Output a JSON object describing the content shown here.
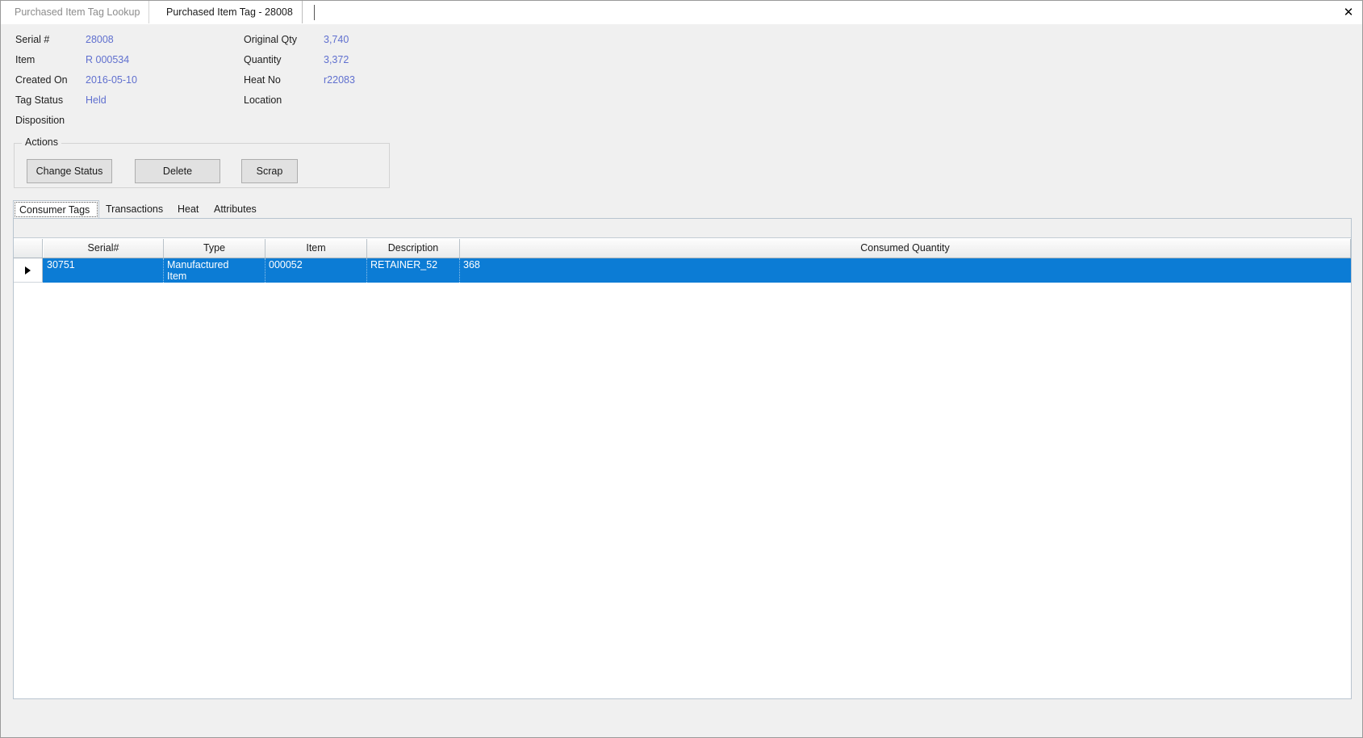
{
  "window": {
    "close_label": "✕"
  },
  "doc_tabs": [
    {
      "label": "Purchased Item Tag Lookup",
      "active": false
    },
    {
      "label": "Purchased Item Tag - 28008",
      "active": true
    }
  ],
  "details": {
    "left_column": [
      {
        "label": "Serial #",
        "value": "28008"
      },
      {
        "label": "Item",
        "value": "R 000534"
      },
      {
        "label": "Created On",
        "value": "2016-05-10"
      },
      {
        "label": "Tag Status",
        "value": "Held"
      },
      {
        "label": "Disposition",
        "value": ""
      }
    ],
    "right_column": [
      {
        "label": "Original Qty",
        "value": "3,740"
      },
      {
        "label": "Quantity",
        "value": "3,372"
      },
      {
        "label": "Heat No",
        "value": "r22083"
      },
      {
        "label": "Location",
        "value": ""
      }
    ]
  },
  "actions": {
    "legend": "Actions",
    "buttons": [
      {
        "label": "Change Status"
      },
      {
        "label": "Delete"
      },
      {
        "label": "Scrap"
      }
    ]
  },
  "inner_tabs": [
    {
      "label": "Consumer Tags",
      "selected": true
    },
    {
      "label": "Transactions",
      "selected": false
    },
    {
      "label": "Heat",
      "selected": false
    },
    {
      "label": "Attributes",
      "selected": false
    }
  ],
  "grid": {
    "columns": [
      "Serial#",
      "Type",
      "Item",
      "Description",
      "Consumed Quantity"
    ],
    "rows": [
      {
        "selected": true,
        "serial": "30751",
        "type": "Manufactured\nItem",
        "item": "000052",
        "description": "RETAINER_52",
        "consumed_quantity": "368"
      }
    ]
  },
  "colors": {
    "selection_blue": "#0c7cd5",
    "value_blue": "#6070cf",
    "panel_gray": "#f0f0f0",
    "button_face": "#e1e1e1"
  }
}
